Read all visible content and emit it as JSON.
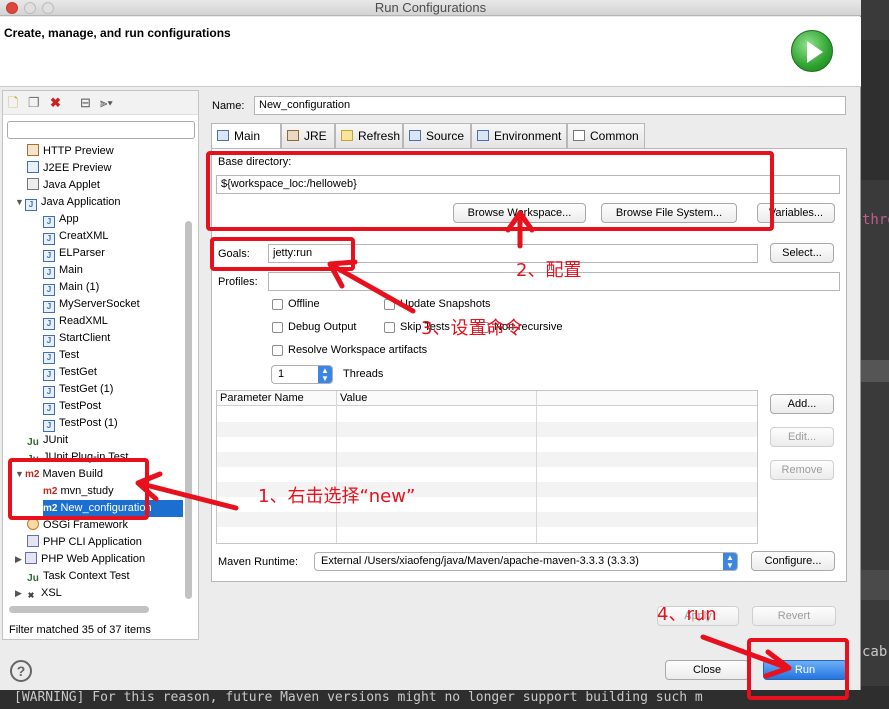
{
  "window": {
    "title": "Run Configurations"
  },
  "header": {
    "title": "Create, manage, and run configurations"
  },
  "background": {
    "console_line": "[WARNING] For this reason, future Maven versions might no longer support building such m",
    "side_text_1": "thro",
    "side_text_2": "cab"
  },
  "tree": {
    "items": [
      {
        "label": "HTTP Preview",
        "icon": "tomcat-icon"
      },
      {
        "label": "J2EE Preview",
        "icon": "j2ee-icon"
      },
      {
        "label": "Java Applet",
        "icon": "applet-icon"
      },
      {
        "label": "Java Application",
        "icon": "java-app-icon"
      },
      {
        "label": "App",
        "icon": "java-config-icon"
      },
      {
        "label": "CreatXML",
        "icon": "java-config-icon"
      },
      {
        "label": "ELParser",
        "icon": "java-config-icon"
      },
      {
        "label": "Main",
        "icon": "java-config-icon"
      },
      {
        "label": "Main (1)",
        "icon": "java-config-icon"
      },
      {
        "label": "MyServerSocket",
        "icon": "java-config-icon"
      },
      {
        "label": "ReadXML",
        "icon": "java-config-icon"
      },
      {
        "label": "StartClient",
        "icon": "java-config-icon"
      },
      {
        "label": "Test",
        "icon": "java-config-icon"
      },
      {
        "label": "TestGet",
        "icon": "java-config-icon"
      },
      {
        "label": "TestGet (1)",
        "icon": "java-config-icon"
      },
      {
        "label": "TestPost",
        "icon": "java-config-icon"
      },
      {
        "label": "TestPost (1)",
        "icon": "java-config-icon"
      },
      {
        "label": "JUnit",
        "icon": "junit-icon"
      },
      {
        "label": "JUnit Plug-in Test",
        "icon": "junit-plugin-icon"
      },
      {
        "label": "Maven Build",
        "icon": "maven-icon"
      },
      {
        "label": "mvn_study",
        "icon": "maven-icon"
      },
      {
        "label": "New_configuration",
        "icon": "maven-icon"
      },
      {
        "label": "OSGi Framework",
        "icon": "osgi-icon"
      },
      {
        "label": "PHP CLI Application",
        "icon": "php-icon"
      },
      {
        "label": "PHP Web Application",
        "icon": "php-web-icon"
      },
      {
        "label": "Task Context Test",
        "icon": "junit-icon"
      },
      {
        "label": "XSL",
        "icon": "xsl-icon"
      }
    ],
    "filter_status": "Filter matched 35 of 37 items"
  },
  "config": {
    "name_label": "Name:",
    "name_value": "New_configuration",
    "tabs": [
      "Main",
      "JRE",
      "Refresh",
      "Source",
      "Environment",
      "Common"
    ],
    "base_dir_label": "Base directory:",
    "base_dir_value": "${workspace_loc:/helloweb}",
    "browse_workspace": "Browse Workspace...",
    "browse_fs": "Browse File System...",
    "variables": "Variables...",
    "goals_label": "Goals:",
    "goals_value": "jetty:run",
    "select": "Select...",
    "profiles_label": "Profiles:",
    "options": [
      "Offline",
      "Update Snapshots",
      "Debug Output",
      "Skip Tests",
      "Non-recursive",
      "Resolve Workspace artifacts"
    ],
    "threads_value": "1",
    "threads_label": "Threads",
    "param_headers": [
      "Parameter Name",
      "Value"
    ],
    "add": "Add...",
    "edit": "Edit...",
    "remove": "Remove",
    "runtime_label": "Maven Runtime:",
    "runtime_value": "External /Users/xiaofeng/java/Maven/apache-maven-3.3.3 (3.3.3)",
    "configure": "Configure...",
    "apply": "Apply",
    "revert": "Revert",
    "close": "Close",
    "run": "Run"
  },
  "annotations": {
    "step1": "1、右击选择“new”",
    "step2": "2、配置",
    "step3": "3、设置命令",
    "step4": "4、run"
  },
  "colors": {
    "annotation": "#e8101c",
    "selection": "#1b6fd0",
    "run_button": "#2374e0"
  }
}
